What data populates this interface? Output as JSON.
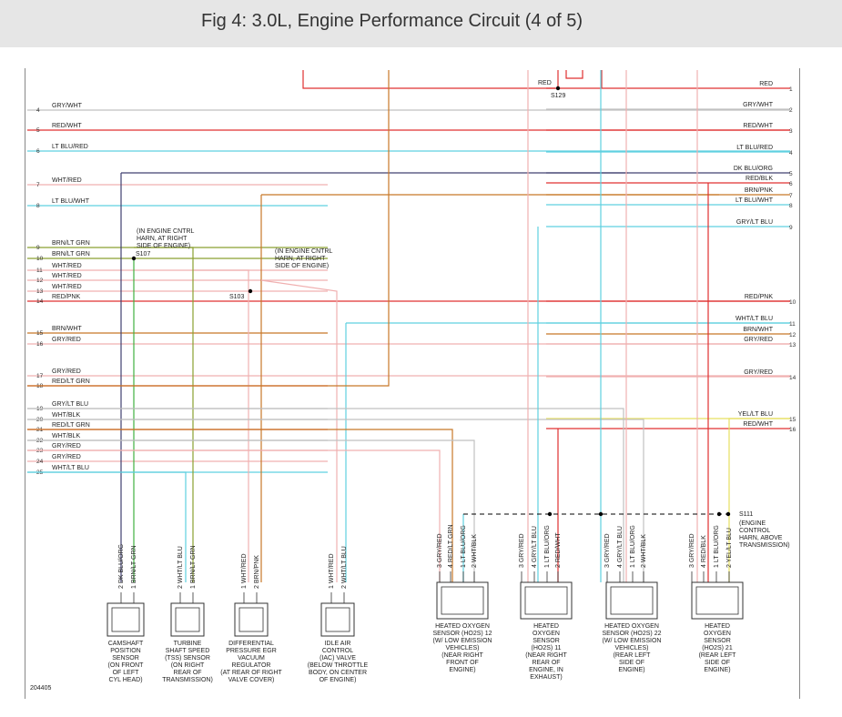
{
  "title": "Fig 4: 3.0L, Engine Performance Circuit (4 of 5)",
  "fig_number": "204405",
  "left_wires": [
    {
      "pin": "4",
      "label": "GRY/WHT"
    },
    {
      "pin": "5",
      "label": "RED/WHT"
    },
    {
      "pin": "6",
      "label": "LT BLU/RED"
    },
    {
      "pin": "7",
      "label": "WHT/RED"
    },
    {
      "pin": "8",
      "label": "LT BLU/WHT"
    },
    {
      "pin": "9",
      "label": "BRN/LT GRN"
    },
    {
      "pin": "10",
      "label": "BRN/LT GRN"
    },
    {
      "pin": "11",
      "label": "WHT/RED"
    },
    {
      "pin": "12",
      "label": "WHT/RED"
    },
    {
      "pin": "13",
      "label": "WHT/RED"
    },
    {
      "pin": "14",
      "label": "RED/PNK"
    },
    {
      "pin": "15",
      "label": "BRN/WHT"
    },
    {
      "pin": "16",
      "label": "GRY/RED"
    },
    {
      "pin": "17",
      "label": "GRY/RED"
    },
    {
      "pin": "18",
      "label": "RED/LT GRN"
    },
    {
      "pin": "19",
      "label": "GRY/LT BLU"
    },
    {
      "pin": "20",
      "label": "WHT/BLK"
    },
    {
      "pin": "21",
      "label": "RED/LT GRN"
    },
    {
      "pin": "22",
      "label": "WHT/BLK"
    },
    {
      "pin": "23",
      "label": "GRY/RED"
    },
    {
      "pin": "24",
      "label": "GRY/RED"
    },
    {
      "pin": "25",
      "label": "WHT/LT BLU"
    }
  ],
  "right_wires": [
    {
      "pin": "1",
      "label": "RED"
    },
    {
      "pin": "2",
      "label": "GRY/WHT"
    },
    {
      "pin": "3",
      "label": "RED/WHT"
    },
    {
      "pin": "4",
      "label": "LT BLU/RED"
    },
    {
      "pin": "5",
      "label": "DK BLU/ORG"
    },
    {
      "pin": "6",
      "label": "RED/BLK"
    },
    {
      "pin": "7",
      "label": "BRN/PNK"
    },
    {
      "pin": "8",
      "label": "LT BLU/WHT"
    },
    {
      "pin": "9",
      "label": "GRY/LT BLU"
    },
    {
      "pin": "10",
      "label": "RED/PNK"
    },
    {
      "pin": "11",
      "label": "WHT/LT BLU"
    },
    {
      "pin": "12",
      "label": "BRN/WHT"
    },
    {
      "pin": "13",
      "label": "GRY/RED"
    },
    {
      "pin": "14",
      "label": "GRY/RED"
    },
    {
      "pin": "15",
      "label": "YEL/LT BLU"
    },
    {
      "pin": "16",
      "label": "RED/WHT"
    }
  ],
  "splices": {
    "s129": "S129",
    "s129_wire": "RED",
    "s107": "S107",
    "s107_note": [
      "(IN ENGINE CNTRL",
      "HARN, AT RIGHT",
      "SIDE OF ENGINE)"
    ],
    "s103": "S103",
    "s103_note": [
      "(IN ENGINE CNTRL",
      "HARN, AT RIGHT",
      "SIDE OF ENGINE)"
    ],
    "s111": "S111",
    "s111_note": [
      "(ENGINE",
      "CONTROL",
      "HARN, ABOVE",
      "TRANSMISSION)"
    ]
  },
  "components": [
    {
      "wires": [
        "DK BLU/ORG",
        "BRN/LT GRN"
      ],
      "pins": [
        "2",
        "1"
      ],
      "caption": [
        "CAMSHAFT",
        "POSITION",
        "SENSOR",
        "(ON FRONT",
        "OF LEFT",
        "CYL HEAD)"
      ]
    },
    {
      "wires": [
        "WHT/LT BLU",
        "BRN/LT GRN"
      ],
      "pins": [
        "2",
        "1"
      ],
      "caption": [
        "TURBINE",
        "SHAFT SPEED",
        "(TSS) SENSOR",
        "(ON RIGHT",
        "REAR OF",
        "TRANSMISSION)"
      ]
    },
    {
      "wires": [
        "WHT/RED",
        "BRN/PNK"
      ],
      "pins": [
        "1",
        "2"
      ],
      "caption": [
        "DIFFERENTIAL",
        "PRESSURE EGR",
        "VACUUM",
        "REGULATOR",
        "(AT REAR OF RIGHT",
        "VALVE COVER)"
      ]
    },
    {
      "wires": [
        "WHT/RED",
        "WHT/LT BLU"
      ],
      "pins": [
        "1",
        "2"
      ],
      "caption": [
        "IDLE AIR",
        "CONTROL",
        "(IAC) VALVE",
        "(BELOW THROTTLE",
        "BODY, ON CENTER",
        "OF ENGINE)"
      ]
    },
    {
      "wires": [
        "GRY/RED",
        "RED/LT GRN",
        "LT BLU/ORG",
        "WHT/BLK"
      ],
      "pins": [
        "3",
        "4",
        "1",
        "2"
      ],
      "caption": [
        "HEATED OXYGEN",
        "SENSOR (HO2S) 12",
        "(W/ LOW EMISSION",
        "VEHICLES)",
        "(NEAR RIGHT",
        "FRONT OF",
        "ENGINE)"
      ]
    },
    {
      "wires": [
        "GRY/RED",
        "GRY/LT BLU",
        "LT BLU/ORG",
        "RED/WHT"
      ],
      "pins": [
        "3",
        "4",
        "1",
        "2"
      ],
      "caption": [
        "HEATED",
        "OXYGEN",
        "SENSOR",
        "(HO2S) 11",
        "(NEAR RIGHT",
        "REAR OF",
        "ENGINE, IN",
        "EXHAUST)"
      ]
    },
    {
      "wires": [
        "GRY/RED",
        "GRY/LT BLU",
        "LT BLU/ORG",
        "WHT/BLK"
      ],
      "pins": [
        "3",
        "4",
        "1",
        "2"
      ],
      "caption": [
        "HEATED OXYGEN",
        "SENSOR (HO2S) 22",
        "(W/ LOW EMISSION",
        "VEHICLES)",
        "(REAR LEFT",
        "SIDE OF",
        "ENGINE)"
      ]
    },
    {
      "wires": [
        "GRY/RED",
        "RED/BLK",
        "LT BLU/ORG",
        "YEL/LT BLU"
      ],
      "pins": [
        "3",
        "4",
        "1",
        "2"
      ],
      "caption": [
        "HEATED",
        "OXYGEN",
        "SENSOR",
        "(HO2S) 21",
        "(REAR LEFT",
        "SIDE OF",
        "ENGINE)"
      ]
    }
  ],
  "colors": {
    "red": "#e03030",
    "gry": "#c0c0c0",
    "ltblu": "#5fd0e0",
    "pink": "#f0b0b0",
    "brn": "#c87828",
    "dkblu": "#404070",
    "olive": "#8aa030",
    "grn": "#40b040",
    "yel": "#e6e060",
    "dash": "#000000"
  }
}
